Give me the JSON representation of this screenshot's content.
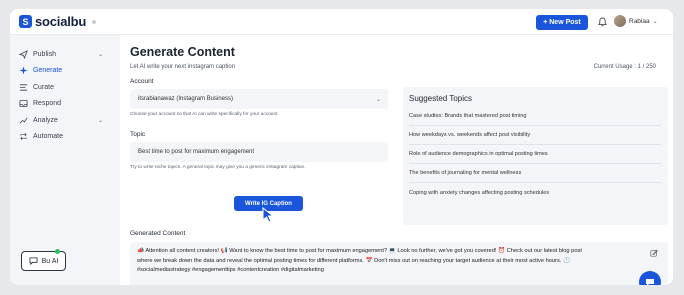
{
  "brand": {
    "name": "socialbu",
    "mark": "S"
  },
  "topbar": {
    "new_post_label": "+ New Post",
    "user_name": "Rabiaa",
    "user_chevron": "⌄"
  },
  "sidebar": {
    "items": [
      {
        "label": "Publish",
        "icon": "send-icon",
        "has_chevron": true
      },
      {
        "label": "Generate",
        "icon": "sparkle-icon",
        "active": true
      },
      {
        "label": "Curate",
        "icon": "list-icon"
      },
      {
        "label": "Respond",
        "icon": "inbox-icon"
      },
      {
        "label": "Analyze",
        "icon": "chart-icon",
        "has_chevron": true
      },
      {
        "label": "Automate",
        "icon": "repeat-icon"
      }
    ],
    "chevron": "⌄",
    "bu_ai_label": "Bu AI"
  },
  "main": {
    "title": "Generate Content",
    "subtitle": "Let AI write your next instagram caption",
    "usage": "Current Usage : 1 / 250",
    "account": {
      "label": "Account",
      "value": "itsrabianawaz (Instagram Business)",
      "helper": "Choose your account so that AI can write specifically for your account",
      "chevron": "⌄"
    },
    "topic": {
      "label": "Topic",
      "value": "Best time to post for maximum engagement",
      "helper": "Try to write niche topics. A general topic may give you a generic instagram caption."
    },
    "write_button": "Write IG Caption",
    "suggested": {
      "title": "Suggested Topics",
      "items": [
        "Case studies: Brands that mastered post timing",
        "How weekdays vs. weekends affect post visibility",
        "Role of audience demographics in optimal posting times",
        "The benefits of journaling for mental wellness",
        "Coping with anxiety changes affecting posting schedules"
      ]
    },
    "generated": {
      "title": "Generated Content",
      "text": "📣 Attention all content creators! 📢 Want to know the best time to post for maximum engagement? 💻 Look no further, we've got you covered! ⏰ Check out our latest blog post where we break down the data and reveal the optimal posting times for different platforms. 📅 Don't miss out on reaching your target audience at their most active hours. 🕐 #socialmediastrategy #engagementtips #contentcreation #digitalmarketing"
    }
  },
  "colors": {
    "accent": "#1a56db",
    "online": "#22c55e"
  }
}
